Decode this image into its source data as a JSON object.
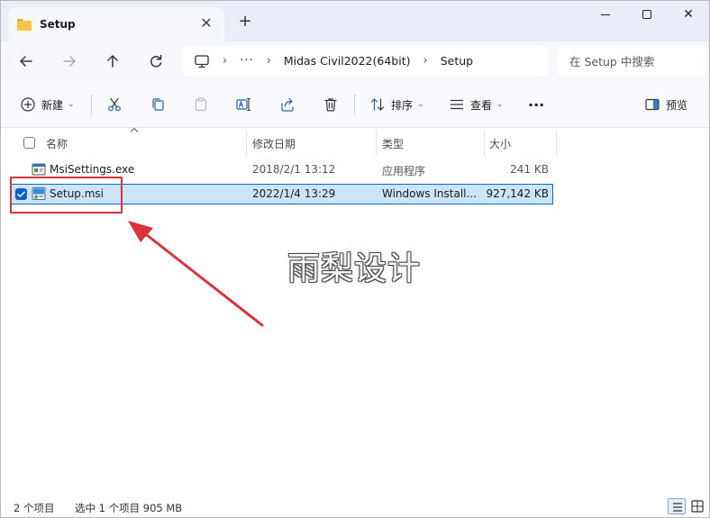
{
  "window": {
    "tab_title": "Setup",
    "tab_close_glyph": "✕",
    "new_tab_glyph": "+",
    "close_glyph": "✕"
  },
  "address": {
    "crumbs": [
      "Midas Civil2022(64bit)",
      "Setup"
    ],
    "overflow": "···",
    "separator": "›",
    "search_placeholder": "在 Setup 中搜索"
  },
  "toolbar": {
    "new_label": "新建",
    "sort_label": "排序",
    "view_label": "查看",
    "more_label": "···",
    "preview_label": "预览",
    "chevron": "⌄"
  },
  "columns": {
    "name": "名称",
    "modified": "修改日期",
    "type": "类型",
    "size": "大小"
  },
  "files": [
    {
      "name": "MsiSettings.exe",
      "modified": "2018/2/1 13:12",
      "type": "应用程序",
      "size": "241 KB",
      "selected": false
    },
    {
      "name": "Setup.msi",
      "modified": "2022/1/4 13:29",
      "type": "Windows Install...",
      "size": "927,142 KB",
      "selected": true
    }
  ],
  "status": {
    "item_count": "2 个项目",
    "selected_info": "选中 1 个项目  905 MB"
  },
  "watermark": "雨梨设计",
  "colors": {
    "accent": "#0e6bc4",
    "selection_bg": "#cce4f7",
    "annotation_red": "#d9323a",
    "titlebar_bg": "#e8edf7"
  },
  "icons": {
    "tab": "folder-icon",
    "back": "arrow-left-icon",
    "forward": "arrow-right-icon",
    "up": "arrow-up-icon",
    "refresh": "refresh-icon",
    "this_pc": "monitor-icon",
    "new": "plus-circle-icon",
    "cut": "scissors-icon",
    "copy": "copy-icon",
    "paste": "clipboard-icon",
    "rename": "rename-icon",
    "share": "share-icon",
    "delete": "trash-icon",
    "sort": "sort-icon",
    "view": "view-lines-icon",
    "preview": "preview-pane-icon",
    "details_view": "details-view-icon",
    "tiles_view": "tiles-view-icon"
  }
}
